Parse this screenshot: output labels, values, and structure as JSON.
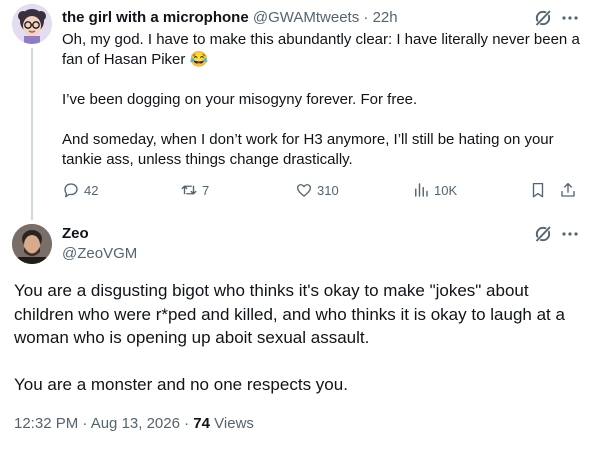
{
  "reply_tweet": {
    "author_name": "the girl with a microphone",
    "author_handle": "@GWAMtweets",
    "separator": "·",
    "time": "22h",
    "paragraphs": [
      "Oh, my god. I have to make this abundantly clear: I have literally never been a fan of Hasan Piker 😂",
      "I’ve been dogging on your misogyny forever. For free.",
      "And someday, when I don’t work for H3 anymore, I’ll still be hating on your tankie ass, unless things change drastically."
    ],
    "stats": {
      "replies": "42",
      "reposts": "7",
      "likes": "310",
      "views": "10K"
    }
  },
  "main_tweet": {
    "author_name": "Zeo",
    "author_handle": "@ZeoVGM",
    "paragraphs": [
      "You are a disgusting bigot who thinks it's okay to make \"jokes\" about children who were r*ped and killed, and who thinks it is okay to laugh at a woman who is opening up aboit sexual assault.",
      "You are a monster and no one respects you."
    ],
    "timestamp": "12:32 PM · Aug 13, 2026 · ",
    "views_count": "74",
    "views_label": "Views"
  },
  "icons": {
    "reply": "reply-icon",
    "repost": "repost-icon",
    "like": "heart-icon",
    "views": "analytics-icon",
    "bookmark": "bookmark-icon",
    "share": "share-icon",
    "grok": "grok-icon",
    "more": "more-icon"
  },
  "colors": {
    "text_primary": "#0f1419",
    "text_secondary": "#536471",
    "thread_line": "#cfd9de"
  }
}
